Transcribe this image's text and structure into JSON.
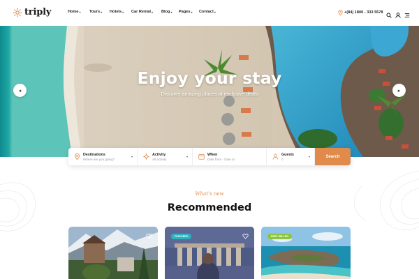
{
  "brand": {
    "name": "triply",
    "accent": "#e08a4c"
  },
  "nav": {
    "items": [
      {
        "label": "Home"
      },
      {
        "label": "Tours"
      },
      {
        "label": "Hotels"
      },
      {
        "label": "Car Rental"
      },
      {
        "label": "Blog"
      },
      {
        "label": "Pages"
      },
      {
        "label": "Contact"
      }
    ]
  },
  "header": {
    "phone": "+(84) 1800 - 333 5578",
    "icons": [
      "search-icon",
      "user-icon",
      "menu-icon"
    ]
  },
  "hero": {
    "title": "Enjoy your stay",
    "subtitle": "Discover amazing places at exclusive deals",
    "prev_icon": "chevron-left-icon",
    "next_icon": "chevron-right-icon"
  },
  "search": {
    "destination": {
      "label": "Destinations",
      "placeholder": "Where are you going?"
    },
    "activity": {
      "label": "Activity",
      "value": "All activity"
    },
    "when": {
      "label": "When",
      "value": "Date from - Date to"
    },
    "guests": {
      "label": "Guests",
      "value": "0"
    },
    "button": "Search"
  },
  "section": {
    "subtitle": "What's new",
    "title": "Recommended"
  },
  "cards": [
    {
      "badge": ""
    },
    {
      "badge": "FEATURED"
    },
    {
      "badge": "BEST SELLER"
    }
  ],
  "colors": {
    "featured": "#2bb3c0",
    "bestseller": "#8cc63f",
    "search_button": "#e08a4c"
  }
}
